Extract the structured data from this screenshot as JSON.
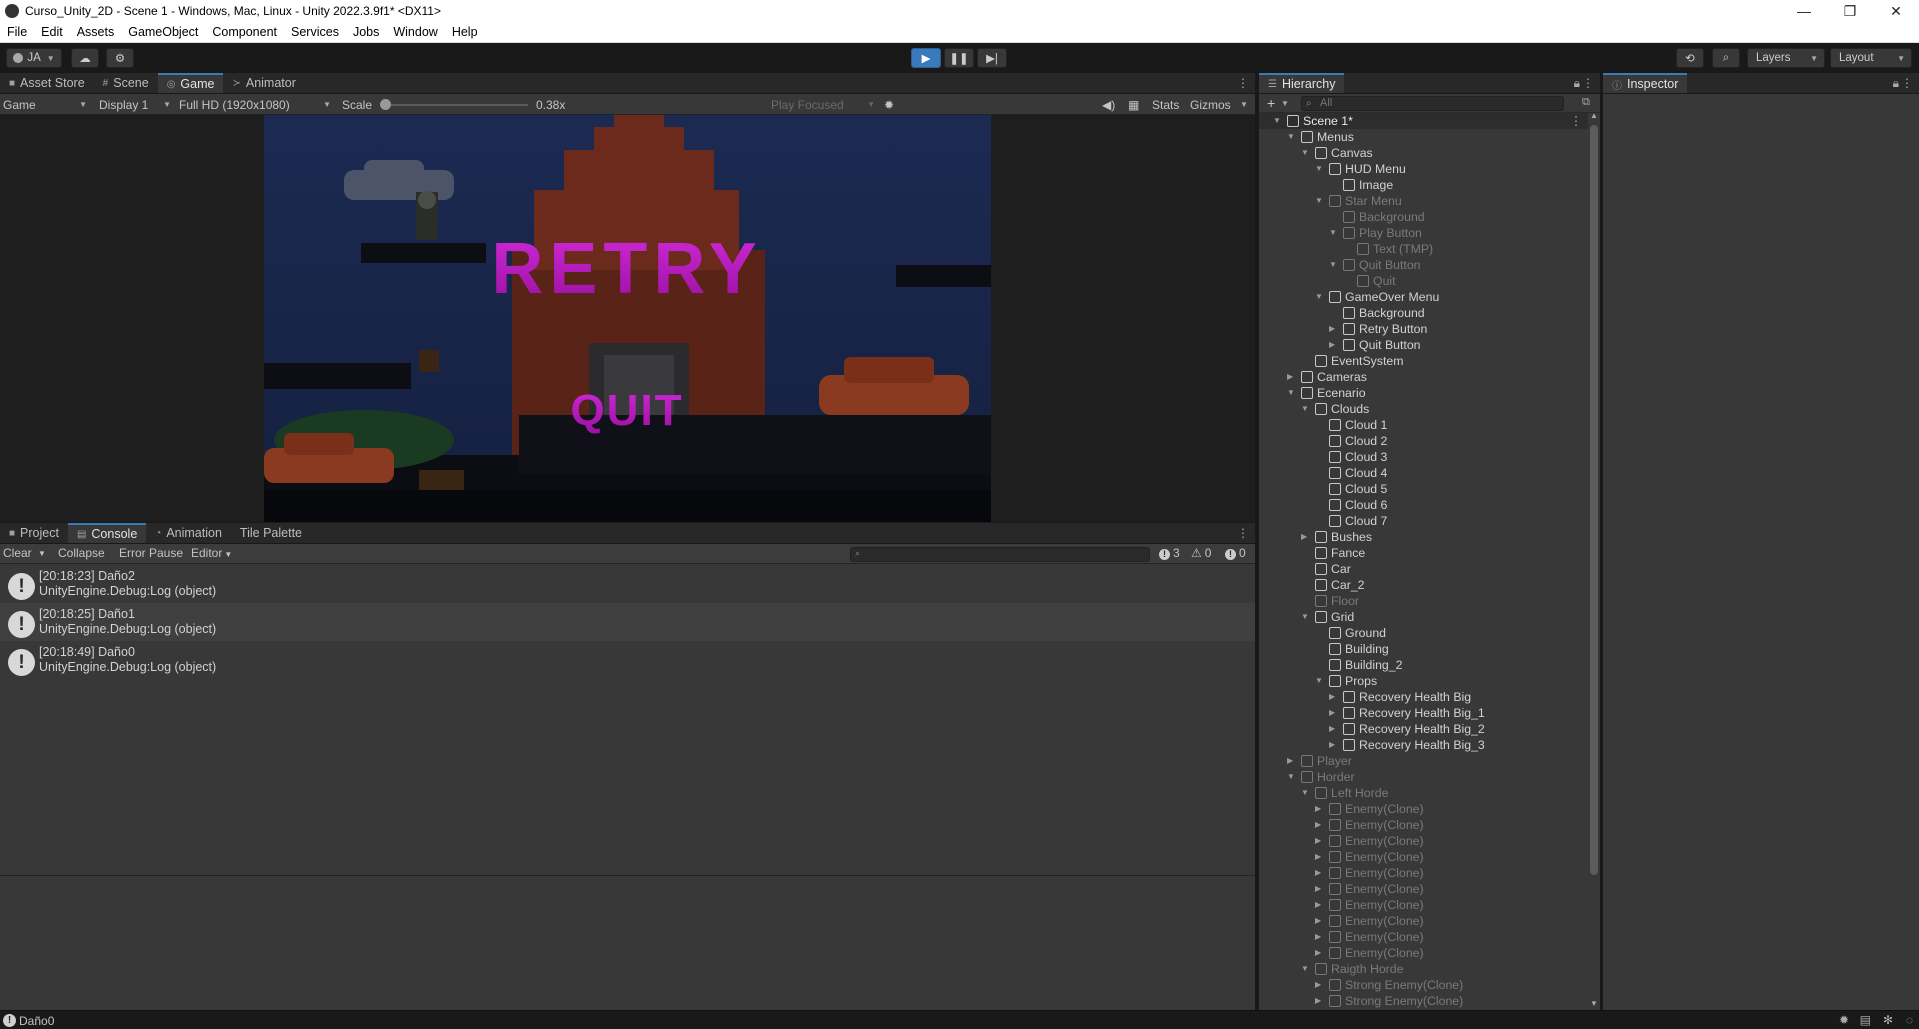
{
  "window": {
    "title": "Curso_Unity_2D - Scene 1 - Windows, Mac, Linux - Unity 2022.3.9f1* <DX11>",
    "controls": [
      "—",
      "❐",
      "✕"
    ]
  },
  "menu": [
    "File",
    "Edit",
    "Assets",
    "GameObject",
    "Component",
    "Services",
    "Jobs",
    "Window",
    "Help"
  ],
  "toolbar": {
    "account": "JA",
    "layers": "Layers",
    "layout": "Layout"
  },
  "top_tabs": [
    "Asset Store",
    "Scene",
    "Game",
    "Animator"
  ],
  "game_view": {
    "mode": "Game",
    "display": "Display 1",
    "resolution": "Full HD (1920x1080)",
    "scale_label": "Scale",
    "scale_value": "0.38x",
    "scale_fraction": 0.0,
    "play_mode": "Play Focused",
    "stats": "Stats",
    "gizmos": "Gizmos",
    "retry": "RETRY",
    "quit": "QUIT",
    "accent_color": "#c020c8"
  },
  "bottom_tabs": [
    "Project",
    "Console",
    "Animation",
    "Tile Palette"
  ],
  "console": {
    "clear": "Clear",
    "collapse": "Collapse",
    "error_pause": "Error Pause",
    "editor": "Editor",
    "count_logs": "3",
    "count_warnings": "0",
    "count_errors": "0",
    "entries": [
      {
        "line1": "[20:18:23] Daño2",
        "line2": "UnityEngine.Debug:Log (object)"
      },
      {
        "line1": "[20:18:25] Daño1",
        "line2": "UnityEngine.Debug:Log (object)"
      },
      {
        "line1": "[20:18:49] Daño0",
        "line2": "UnityEngine.Debug:Log (object)"
      }
    ]
  },
  "hierarchy": {
    "tab": "Hierarchy",
    "search_placeholder": "All",
    "rows": [
      {
        "label": "Scene 1*",
        "depth": 0,
        "arrow": "down",
        "scene": true
      },
      {
        "label": "Menus",
        "depth": 1,
        "arrow": "down"
      },
      {
        "label": "Canvas",
        "depth": 2,
        "arrow": "down"
      },
      {
        "label": "HUD Menu",
        "depth": 3,
        "arrow": "down"
      },
      {
        "label": "Image",
        "depth": 4,
        "arrow": "none"
      },
      {
        "label": "Star Menu",
        "depth": 3,
        "arrow": "down",
        "disabled": true
      },
      {
        "label": "Background",
        "depth": 4,
        "arrow": "none",
        "disabled": true
      },
      {
        "label": "Play Button",
        "depth": 4,
        "arrow": "down",
        "disabled": true
      },
      {
        "label": "Text (TMP)",
        "depth": 5,
        "arrow": "none",
        "disabled": true
      },
      {
        "label": "Quit Button",
        "depth": 4,
        "arrow": "down",
        "disabled": true
      },
      {
        "label": "Quit",
        "depth": 5,
        "arrow": "none",
        "disabled": true
      },
      {
        "label": "GameOver Menu",
        "depth": 3,
        "arrow": "down"
      },
      {
        "label": "Background",
        "depth": 4,
        "arrow": "none"
      },
      {
        "label": "Retry Button",
        "depth": 4,
        "arrow": "right"
      },
      {
        "label": "Quit Button",
        "depth": 4,
        "arrow": "right"
      },
      {
        "label": "EventSystem",
        "depth": 2,
        "arrow": "none"
      },
      {
        "label": "Cameras",
        "depth": 1,
        "arrow": "right"
      },
      {
        "label": "Ecenario",
        "depth": 1,
        "arrow": "down"
      },
      {
        "label": "Clouds",
        "depth": 2,
        "arrow": "down"
      },
      {
        "label": "Cloud 1",
        "depth": 3,
        "arrow": "none"
      },
      {
        "label": "Cloud 2",
        "depth": 3,
        "arrow": "none"
      },
      {
        "label": "Cloud 3",
        "depth": 3,
        "arrow": "none"
      },
      {
        "label": "Cloud 4",
        "depth": 3,
        "arrow": "none"
      },
      {
        "label": "Cloud 5",
        "depth": 3,
        "arrow": "none"
      },
      {
        "label": "Cloud 6",
        "depth": 3,
        "arrow": "none"
      },
      {
        "label": "Cloud 7",
        "depth": 3,
        "arrow": "none"
      },
      {
        "label": "Bushes",
        "depth": 2,
        "arrow": "right"
      },
      {
        "label": "Fance",
        "depth": 2,
        "arrow": "none"
      },
      {
        "label": "Car",
        "depth": 2,
        "arrow": "none"
      },
      {
        "label": "Car_2",
        "depth": 2,
        "arrow": "none"
      },
      {
        "label": "Floor",
        "depth": 2,
        "arrow": "none",
        "disabled": true
      },
      {
        "label": "Grid",
        "depth": 2,
        "arrow": "down"
      },
      {
        "label": "Ground",
        "depth": 3,
        "arrow": "none"
      },
      {
        "label": "Building",
        "depth": 3,
        "arrow": "none"
      },
      {
        "label": "Building_2",
        "depth": 3,
        "arrow": "none"
      },
      {
        "label": "Props",
        "depth": 3,
        "arrow": "down"
      },
      {
        "label": "Recovery Health Big",
        "depth": 4,
        "arrow": "right"
      },
      {
        "label": "Recovery Health Big_1",
        "depth": 4,
        "arrow": "right"
      },
      {
        "label": "Recovery Health Big_2",
        "depth": 4,
        "arrow": "right"
      },
      {
        "label": "Recovery Health Big_3",
        "depth": 4,
        "arrow": "right"
      },
      {
        "label": "Player",
        "depth": 1,
        "arrow": "right",
        "disabled": true
      },
      {
        "label": "Horder",
        "depth": 1,
        "arrow": "down",
        "disabled": true
      },
      {
        "label": "Left Horde",
        "depth": 2,
        "arrow": "down",
        "disabled": true
      },
      {
        "label": "Enemy(Clone)",
        "depth": 3,
        "arrow": "right",
        "disabled": true
      },
      {
        "label": "Enemy(Clone)",
        "depth": 3,
        "arrow": "right",
        "disabled": true
      },
      {
        "label": "Enemy(Clone)",
        "depth": 3,
        "arrow": "right",
        "disabled": true
      },
      {
        "label": "Enemy(Clone)",
        "depth": 3,
        "arrow": "right",
        "disabled": true
      },
      {
        "label": "Enemy(Clone)",
        "depth": 3,
        "arrow": "right",
        "disabled": true
      },
      {
        "label": "Enemy(Clone)",
        "depth": 3,
        "arrow": "right",
        "disabled": true
      },
      {
        "label": "Enemy(Clone)",
        "depth": 3,
        "arrow": "right",
        "disabled": true
      },
      {
        "label": "Enemy(Clone)",
        "depth": 3,
        "arrow": "right",
        "disabled": true
      },
      {
        "label": "Enemy(Clone)",
        "depth": 3,
        "arrow": "right",
        "disabled": true
      },
      {
        "label": "Enemy(Clone)",
        "depth": 3,
        "arrow": "right",
        "disabled": true
      },
      {
        "label": "Raigth Horde",
        "depth": 2,
        "arrow": "down",
        "disabled": true
      },
      {
        "label": "Strong Enemy(Clone)",
        "depth": 3,
        "arrow": "right",
        "disabled": true
      },
      {
        "label": "Strong Enemy(Clone)",
        "depth": 3,
        "arrow": "right",
        "disabled": true
      }
    ]
  },
  "inspector": {
    "tab": "Inspector"
  },
  "status": {
    "text": "Daño0"
  }
}
